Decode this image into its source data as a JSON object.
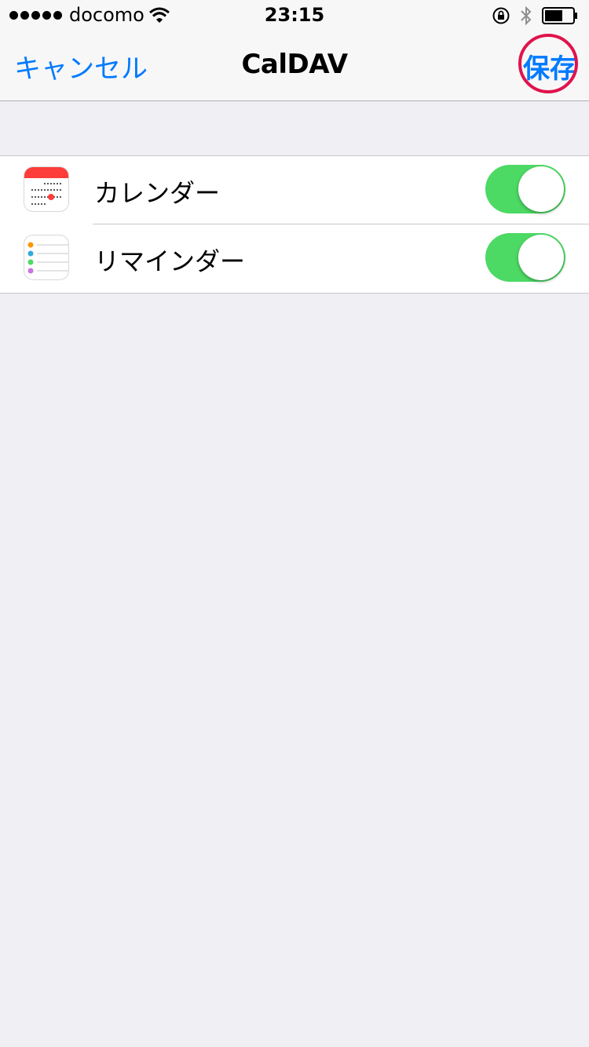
{
  "status_bar": {
    "carrier": "docomo",
    "time": "23:15",
    "signal_icon": "signal-dots-icon",
    "wifi_icon": "wifi-icon",
    "orientation_lock_icon": "orientation-lock-icon",
    "bluetooth_icon": "bluetooth-icon",
    "battery_icon": "battery-icon"
  },
  "nav": {
    "title": "CalDAV",
    "cancel_label": "キャンセル",
    "save_label": "保存"
  },
  "rows": [
    {
      "label": "カレンダー",
      "icon": "calendar-app-icon",
      "enabled": true
    },
    {
      "label": "リマインダー",
      "icon": "reminders-app-icon",
      "enabled": true
    }
  ],
  "colors": {
    "accent": "#007aff",
    "toggle_on": "#4cd964",
    "highlight_ring": "#e0134d",
    "background": "#efeff4"
  }
}
